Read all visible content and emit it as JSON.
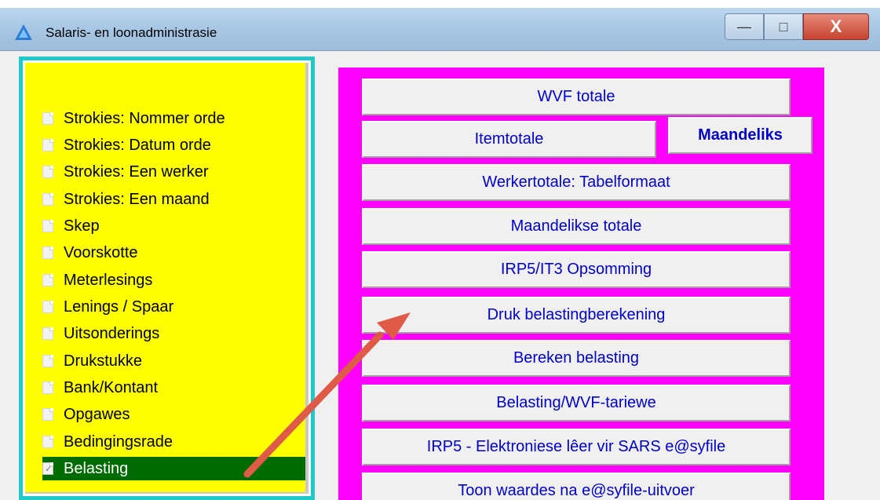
{
  "colors": {
    "left_panel_border": "#22c8c8",
    "left_panel_bg": "#ffff00",
    "selected_item_bg": "#006b00",
    "right_panel_bg": "#ff00ff",
    "button_text": "#0000c8",
    "arrow": "#e05a48"
  },
  "window": {
    "title": "Salaris- en loonadministrasie",
    "app_icon": "blue-triangle-logo-icon",
    "controls": {
      "minimize": "—",
      "maximize": "□",
      "close": "X"
    }
  },
  "menu": {
    "items": [
      {
        "label": "Strokies: Nommer orde",
        "icon": "document-icon"
      },
      {
        "label": "Strokies: Datum orde",
        "icon": "document-icon"
      },
      {
        "label": "Strokies: Een werker",
        "icon": "document-icon"
      },
      {
        "label": "Strokies: Een maand",
        "icon": "document-icon"
      },
      {
        "label": "Skep",
        "icon": "document-icon"
      },
      {
        "label": "Voorskotte",
        "icon": "document-icon"
      },
      {
        "label": "Meterlesings",
        "icon": "document-icon"
      },
      {
        "label": "Lenings / Spaar",
        "icon": "document-icon"
      },
      {
        "label": "Uitsonderings",
        "icon": "document-icon"
      },
      {
        "label": "Drukstukke",
        "icon": "document-icon"
      },
      {
        "label": "Bank/Kontant",
        "icon": "document-icon"
      },
      {
        "label": "Opgawes",
        "icon": "document-icon"
      },
      {
        "label": "Bedingingsrade",
        "icon": "document-icon"
      },
      {
        "label": "Belasting",
        "icon": "checked-document-icon",
        "selected": true
      }
    ]
  },
  "actions": {
    "wvf_totale": "WVF totale",
    "itemtotale": "Itemtotale",
    "maandeliks": "Maandeliks",
    "werkertotale": "Werkertotale: Tabelformaat",
    "maandelikse_totale": "Maandelikse totale",
    "irp5_it3": "IRP5/IT3 Opsomming",
    "druk_belasting": "Druk belastingberekening",
    "bereken_belasting": "Bereken belasting",
    "belasting_wvf": "Belasting/WVF-tariewe",
    "irp5_elektronies": "IRP5 - Elektroniese lêer vir SARS e@syfile",
    "toon_waardes": "Toon waardes na e@syfile-uitvoer"
  },
  "annotation": {
    "arrow": "arrow-pointer-icon"
  }
}
